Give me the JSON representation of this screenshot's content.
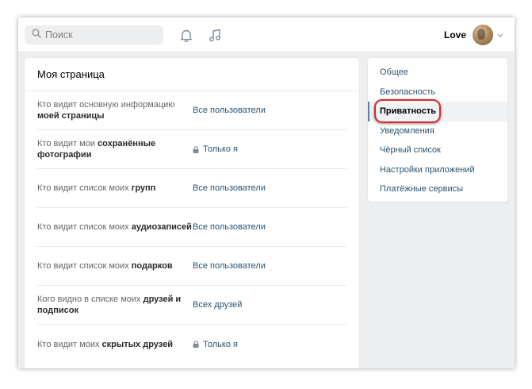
{
  "topbar": {
    "search_placeholder": "Поиск",
    "icons": [
      "search-icon",
      "bell-icon",
      "music-note-icon",
      "chevron-down-icon"
    ],
    "user_name": "Love"
  },
  "main": {
    "title": "Моя страница",
    "rows": [
      {
        "label_plain": "Кто видит основную информацию ",
        "label_bold": "моей страницы",
        "value": "Все пользователи",
        "locked": false
      },
      {
        "label_plain": "Кто видит мои ",
        "label_bold": "сохранённые фотографии",
        "value": "Только я",
        "locked": true
      },
      {
        "label_plain": "Кто видит список моих ",
        "label_bold": "групп",
        "value": "Все пользователи",
        "locked": false
      },
      {
        "label_plain": "Кто видит список моих ",
        "label_bold": "аудиозаписей",
        "value": "Все пользователи",
        "locked": false
      },
      {
        "label_plain": "Кто видит список моих ",
        "label_bold": "подарков",
        "value": "Все пользователи",
        "locked": false
      },
      {
        "label_plain": "Кого видно в списке моих ",
        "label_bold": "друзей и подписок",
        "value": "Всех друзей",
        "locked": false
      },
      {
        "label_plain": "Кто видит моих ",
        "label_bold": "скрытых друзей",
        "value": "Только я",
        "locked": true
      }
    ]
  },
  "side": {
    "items": [
      {
        "label": "Общее",
        "active": false
      },
      {
        "label": "Безопасность",
        "active": false
      },
      {
        "label": "Приватность",
        "active": true
      },
      {
        "label": "Уведомления",
        "active": false
      },
      {
        "label": "Чёрный список",
        "active": false
      },
      {
        "label": "Настройки приложений",
        "active": false
      },
      {
        "label": "Платёжные сервисы",
        "active": false
      }
    ]
  },
  "colors": {
    "link": "#285473",
    "accent": "#5181b8",
    "highlight": "#d62a2a",
    "background": "#edeef0"
  }
}
